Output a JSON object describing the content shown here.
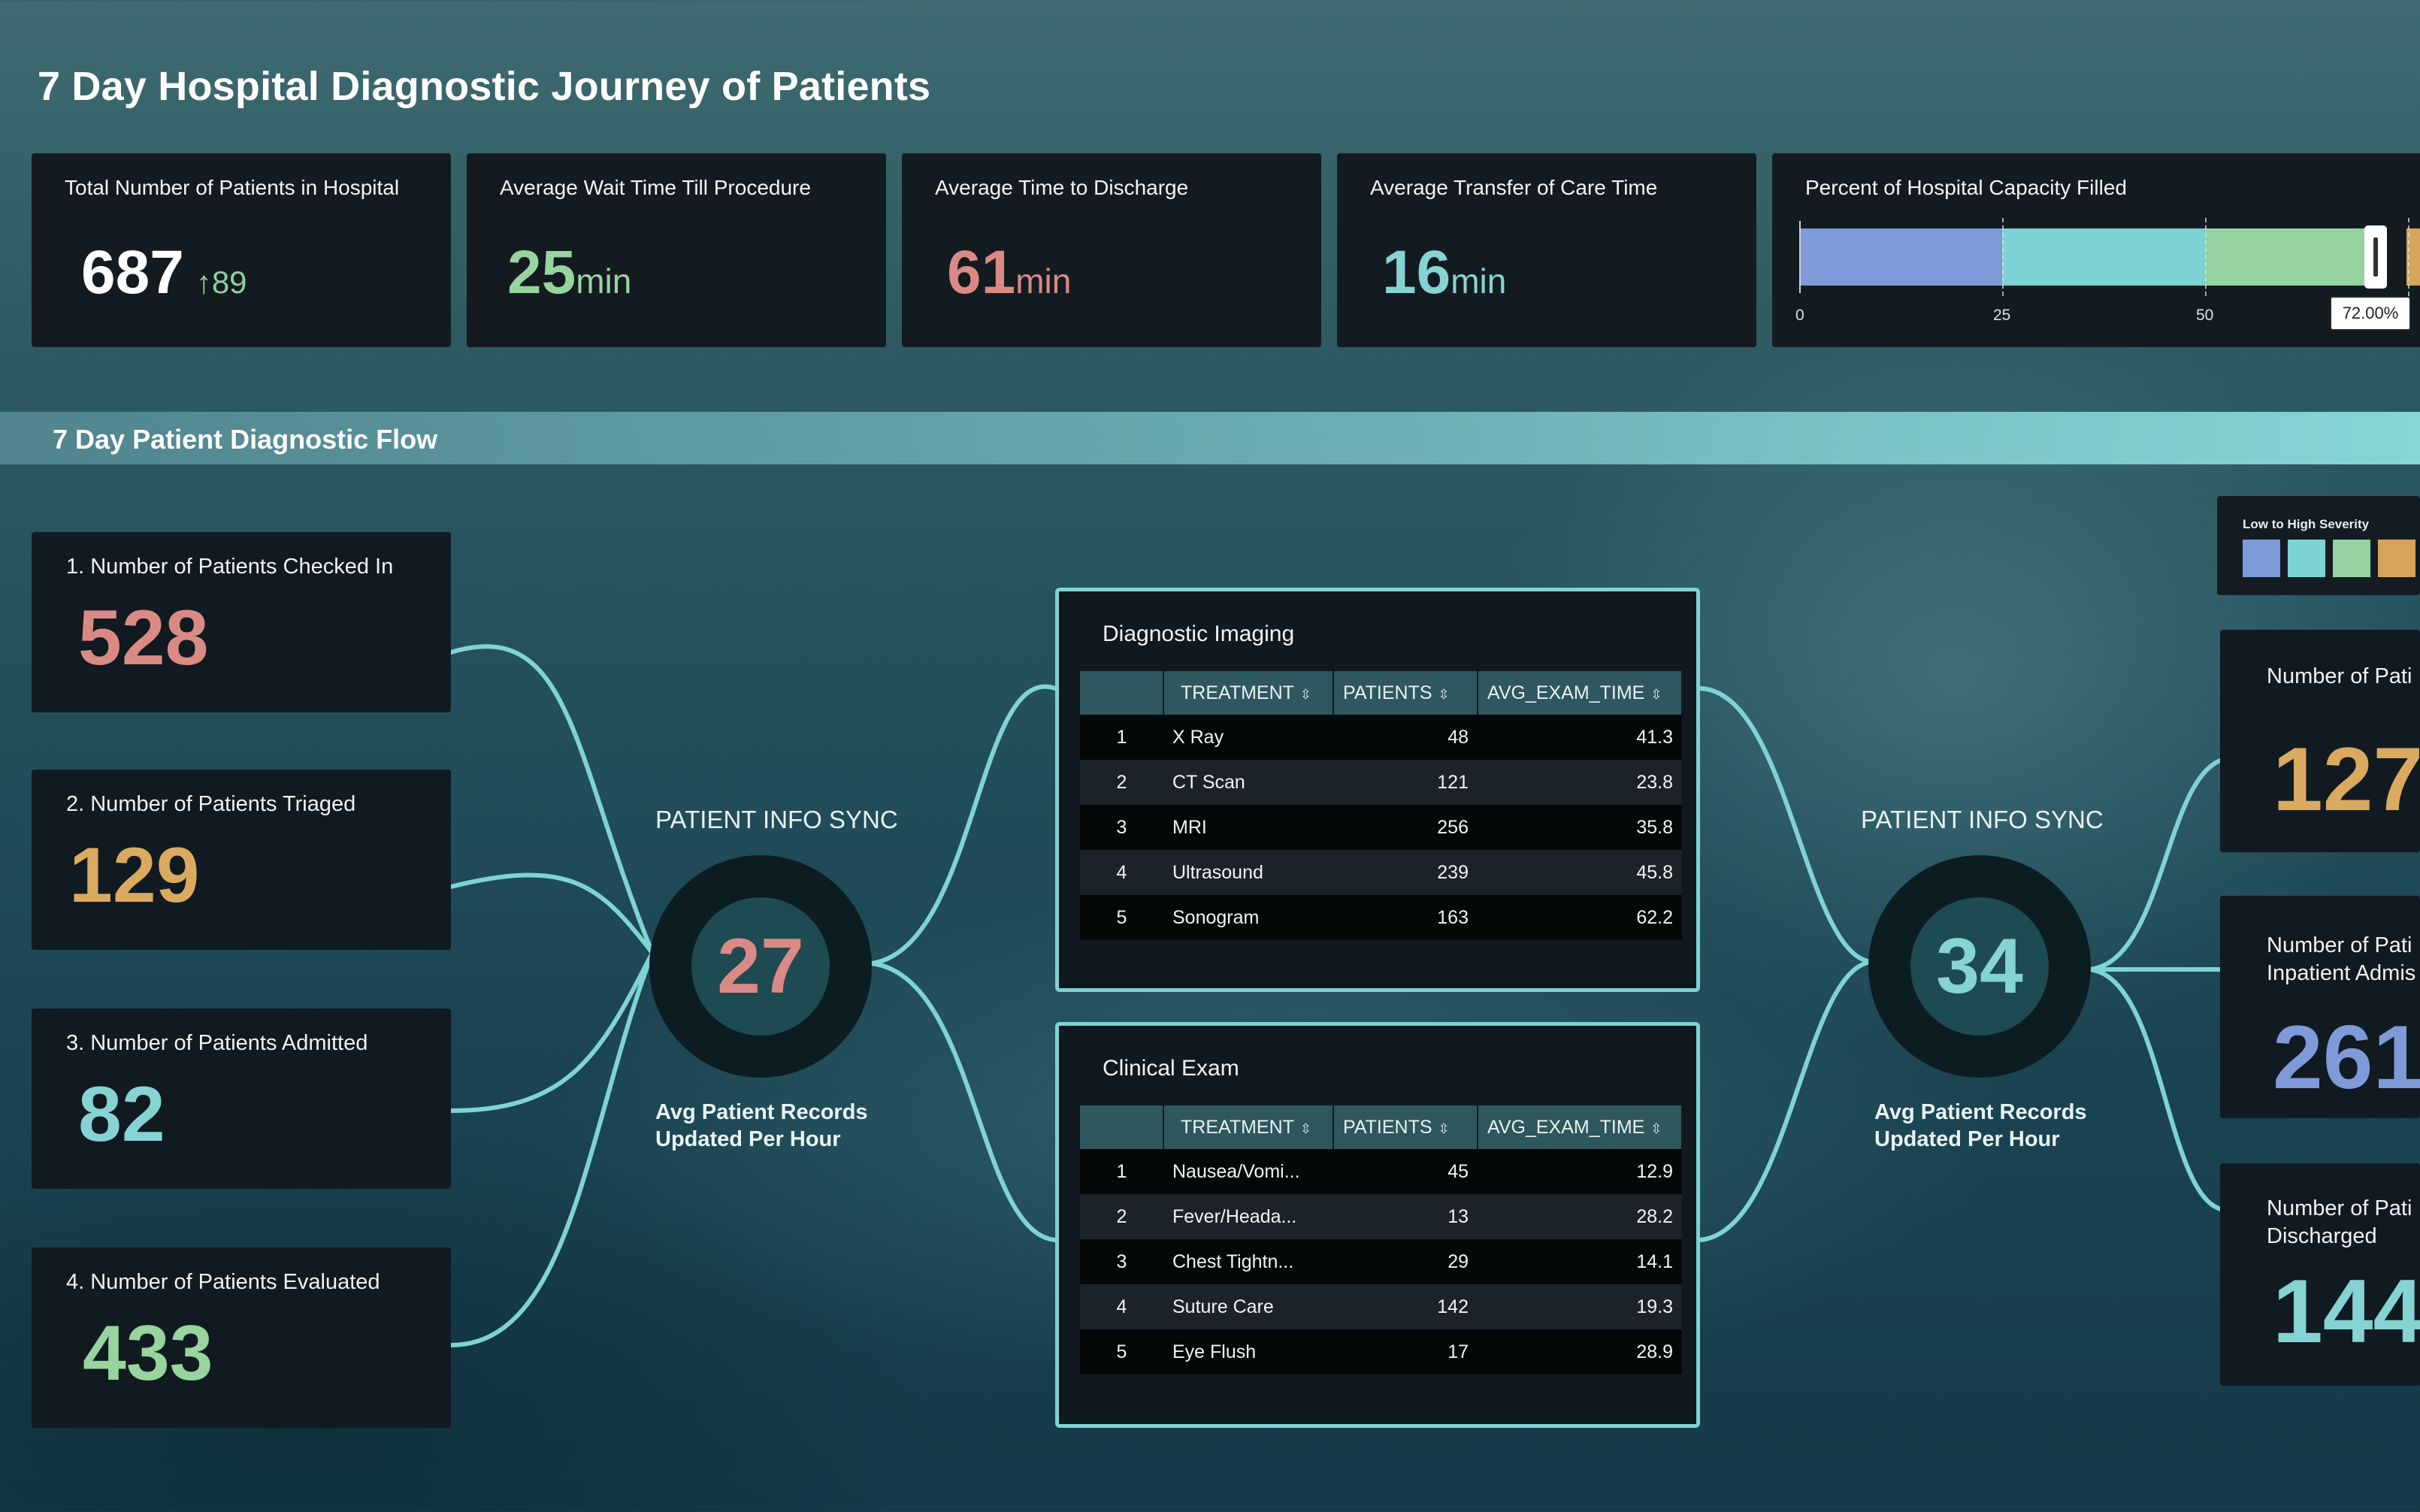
{
  "page": {
    "title": "7 Day Hospital Diagnostic Journey of Patients"
  },
  "kpis": {
    "total_patients": {
      "label": "Total Number of Patients in Hospital",
      "value": "687",
      "delta_icon": "arrow-up-icon",
      "delta": "89"
    },
    "wait_time": {
      "label": "Average Wait Time Till Procedure",
      "value": "25",
      "unit": "min"
    },
    "discharge_time": {
      "label": "Average Time to Discharge",
      "value": "61",
      "unit": "min"
    },
    "transfer_time": {
      "label": "Average Transfer of Care Time",
      "value": "16",
      "unit": "min"
    },
    "capacity": {
      "label": "Percent of Hospital Capacity Filled",
      "percent": 72.0,
      "value_label": "72.00%",
      "ticks": [
        "0",
        "25",
        "50"
      ],
      "segment_colors": [
        "#7e9ad8",
        "#7dd3d3",
        "#94d3a0",
        "#d4a45a"
      ]
    }
  },
  "section": {
    "title": "7 Day Patient Diagnostic Flow"
  },
  "stages": [
    {
      "label": "1. Number of Patients Checked In",
      "value": "528",
      "color": "#d98a84"
    },
    {
      "label": "2. Number of Patients Triaged",
      "value": "129",
      "color": "#d9aa5f"
    },
    {
      "label": "3. Number of Patients Admitted",
      "value": "82",
      "color": "#86d3d3"
    },
    {
      "label": "4. Number of Patients Evaluated",
      "value": "433",
      "color": "#97d49e"
    }
  ],
  "sync_left": {
    "title": "PATIENT INFO SYNC",
    "value": "27",
    "color": "#d98a84",
    "subtitle_1": "Avg Patient Records",
    "subtitle_2": "Updated Per Hour"
  },
  "sync_right": {
    "title": "PATIENT INFO SYNC",
    "value": "34",
    "color": "#86d3d3",
    "subtitle_1": "Avg Patient Records",
    "subtitle_2": "Updated Per Hour"
  },
  "imaging": {
    "title": "Diagnostic Imaging",
    "columns": [
      "TREATMENT",
      "PATIENTS",
      "AVG_EXAM_TIME"
    ],
    "rows": [
      {
        "idx": "1",
        "treatment": "X Ray",
        "patients": "48",
        "avg": "41.3"
      },
      {
        "idx": "2",
        "treatment": "CT Scan",
        "patients": "121",
        "avg": "23.8"
      },
      {
        "idx": "3",
        "treatment": "MRI",
        "patients": "256",
        "avg": "35.8"
      },
      {
        "idx": "4",
        "treatment": "Ultrasound",
        "patients": "239",
        "avg": "45.8"
      },
      {
        "idx": "5",
        "treatment": "Sonogram",
        "patients": "163",
        "avg": "62.2"
      }
    ]
  },
  "clinical": {
    "title": "Clinical Exam",
    "columns": [
      "TREATMENT",
      "PATIENTS",
      "AVG_EXAM_TIME"
    ],
    "rows": [
      {
        "idx": "1",
        "treatment": "Nausea/Vomi...",
        "patients": "45",
        "avg": "12.9"
      },
      {
        "idx": "2",
        "treatment": "Fever/Heada...",
        "patients": "13",
        "avg": "28.2"
      },
      {
        "idx": "3",
        "treatment": "Chest Tightn...",
        "patients": "29",
        "avg": "14.1"
      },
      {
        "idx": "4",
        "treatment": "Suture Care",
        "patients": "142",
        "avg": "19.3"
      },
      {
        "idx": "5",
        "treatment": "Eye Flush",
        "patients": "17",
        "avg": "28.9"
      }
    ]
  },
  "legend": {
    "title": "Low to High Severity",
    "colors": [
      "#7e9ad8",
      "#7dd3d3",
      "#94d3a0",
      "#d4a45a"
    ]
  },
  "outcomes": [
    {
      "label_line1": "Number of Pati",
      "label_line2": "",
      "value": "127",
      "color": "#d9aa5f"
    },
    {
      "label_line1": "Number of Pati",
      "label_line2": "Inpatient Admis",
      "value": "261",
      "color": "#7e9ad8"
    },
    {
      "label_line1": "Number of Pati",
      "label_line2": "Discharged",
      "value": "144",
      "color": "#86d3d3"
    }
  ]
}
